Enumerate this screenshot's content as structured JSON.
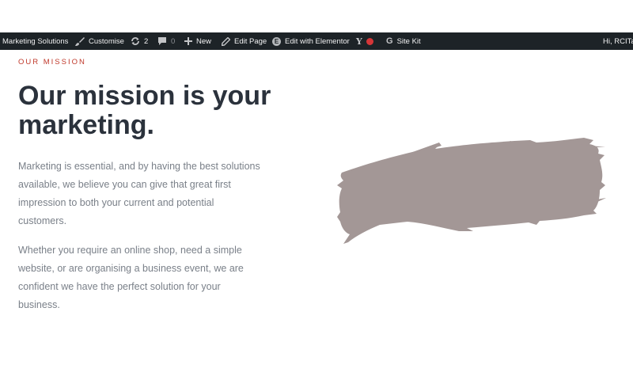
{
  "adminbar": {
    "site_name": "Marketing Solutions",
    "customise": "Customise",
    "updates_count": "2",
    "comments_count": "0",
    "new": "New",
    "edit_page": "Edit Page",
    "elementor": "Edit with Elementor",
    "site_kit": "Site Kit",
    "greeting": "Hi, RCITac",
    "icons": [
      "site-icon",
      "brush-icon",
      "updates-icon",
      "comment-icon",
      "plus-icon",
      "pencil-icon",
      "elementor-icon",
      "yoast-icon",
      "seo-status-dot",
      "google-icon"
    ],
    "colors": {
      "background": "#1d2327",
      "text": "#f0f0f1",
      "status_dot": "#d63638"
    }
  },
  "section": {
    "eyebrow": "OUR MISSION",
    "headline": "Our mission is your marketing.",
    "paragraphs": [
      "Marketing is essential, and by having the best solutions available, we believe you can give that great first impression to both your current and potential customers.",
      "Whether you require an online shop, need a simple website, or are organising a business event, we are confident we have the perfect solution for your business."
    ],
    "colors": {
      "eyebrow": "#c0392b",
      "headline": "#2b323c",
      "body": "#7a8089",
      "brush": "#a39796"
    }
  }
}
